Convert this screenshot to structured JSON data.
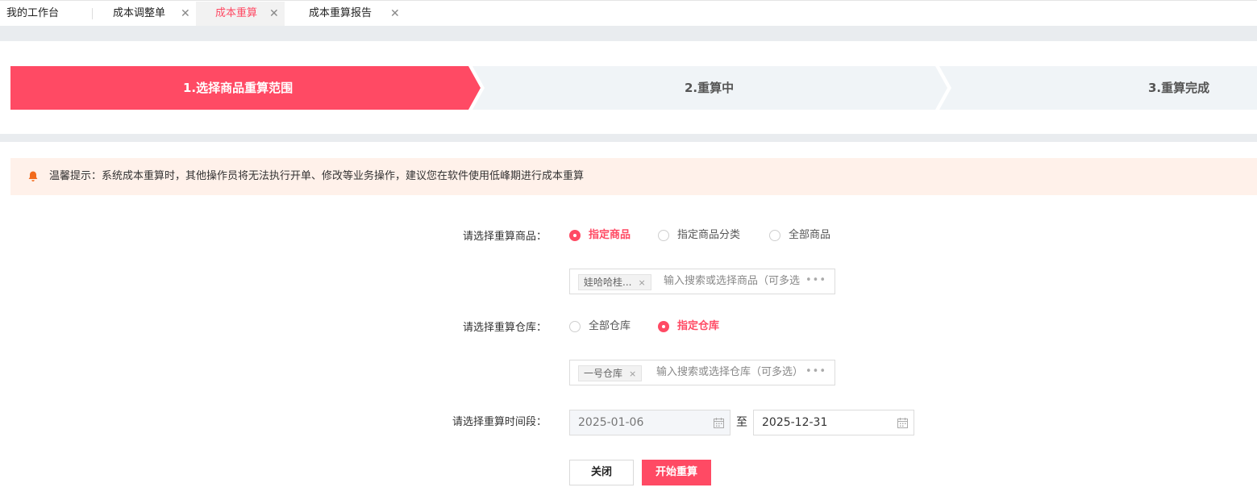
{
  "tabs": [
    {
      "label": "我的工作台",
      "closable": false,
      "active": false
    },
    {
      "label": "成本调整单",
      "closable": true,
      "active": false
    },
    {
      "label": "成本重算",
      "closable": true,
      "active": true
    },
    {
      "label": "成本重算报告",
      "closable": true,
      "active": false
    }
  ],
  "close_glyph": "✕",
  "steps": [
    {
      "label": "1.选择商品重算范围",
      "state": "active"
    },
    {
      "label": "2.重算中",
      "state": "pending"
    },
    {
      "label": "3.重算完成",
      "state": "pending"
    }
  ],
  "notice": {
    "icon": "bell-icon",
    "text": "温馨提示：系统成本重算时，其他操作员将无法执行开单、修改等业务操作，建议您在软件使用低峰期进行成本重算"
  },
  "form": {
    "goods": {
      "label": "请选择重算商品：",
      "options": [
        {
          "label": "指定商品",
          "checked": true
        },
        {
          "label": "指定商品分类",
          "checked": false
        },
        {
          "label": "全部商品",
          "checked": false
        }
      ],
      "selected_tag": "娃哈哈桂...",
      "placeholder": "输入搜索或选择商品（可多选",
      "more": "•••"
    },
    "warehouse": {
      "label": "请选择重算仓库：",
      "options": [
        {
          "label": "全部仓库",
          "checked": false
        },
        {
          "label": "指定仓库",
          "checked": true
        }
      ],
      "selected_tag": "一号仓库",
      "placeholder": "输入搜索或选择仓库（可多选）",
      "more": "•••"
    },
    "period": {
      "label": "请选择重算时间段：",
      "start": "2025-01-06",
      "to": "至",
      "end": "2025-12-31"
    }
  },
  "buttons": {
    "close": "关闭",
    "start": "开始重算"
  },
  "colors": {
    "accent": "#ff4a64",
    "step_pending_bg": "#f0f4f7",
    "notice_bg": "#fff1ea",
    "bell": "#f26b1d"
  }
}
